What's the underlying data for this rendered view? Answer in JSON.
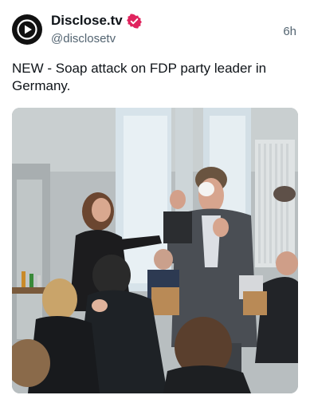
{
  "post": {
    "author": {
      "display_name": "Disclose.tv",
      "handle": "@disclosetv",
      "avatar_icon": "play-logo-icon",
      "verified_icon": "verified-badge-icon",
      "verified_color": "#e0245e"
    },
    "timestamp": "6h",
    "text": "NEW - Soap attack on FDP party leader in Germany.",
    "media": {
      "type": "video-still"
    }
  }
}
